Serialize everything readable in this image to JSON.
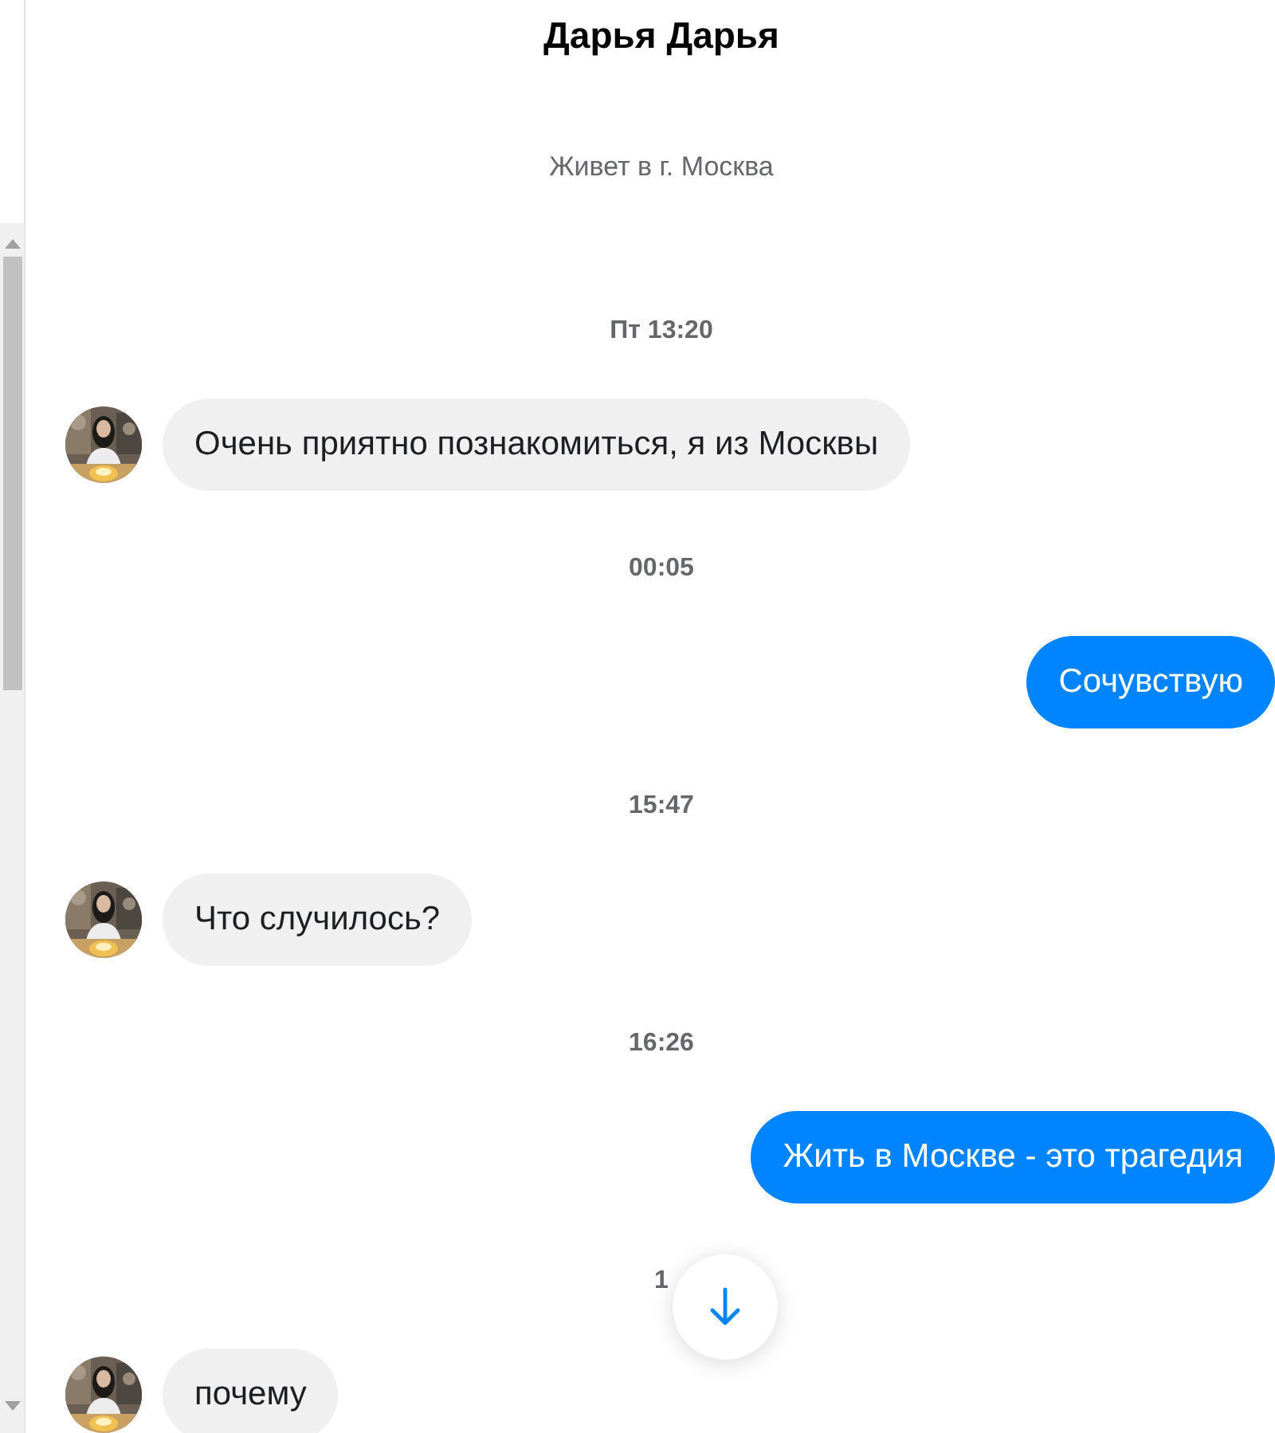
{
  "header": {
    "title": "Дарья Дарья",
    "subtitle": "Живет в г. Москва"
  },
  "messages": [
    {
      "kind": "timestamp",
      "text": "Пт 13:20"
    },
    {
      "kind": "incoming",
      "text": "Очень приятно познакомиться, я из Москвы"
    },
    {
      "kind": "timestamp",
      "text": "00:05"
    },
    {
      "kind": "outgoing",
      "text": "Сочувствую"
    },
    {
      "kind": "timestamp",
      "text": "15:47"
    },
    {
      "kind": "incoming",
      "text": "Что случилось?"
    },
    {
      "kind": "timestamp",
      "text": "16:26"
    },
    {
      "kind": "outgoing",
      "text": "Жить в Москве - это трагедия"
    },
    {
      "kind": "timestamp",
      "text": "1"
    },
    {
      "kind": "incoming",
      "text": "почему"
    }
  ]
}
